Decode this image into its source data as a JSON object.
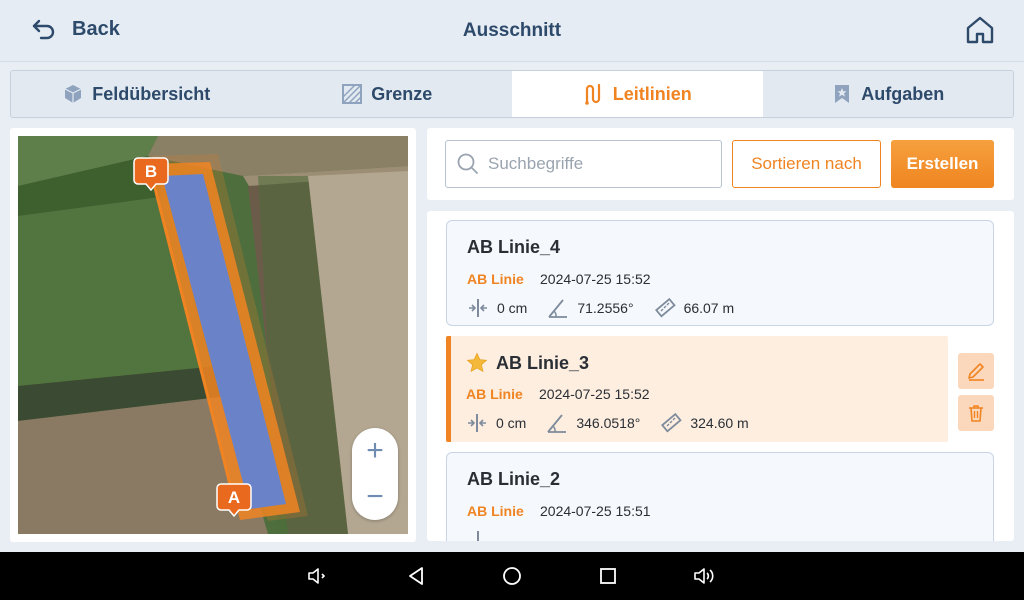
{
  "header": {
    "back_label": "Back",
    "title": "Ausschnitt"
  },
  "tabs": [
    {
      "label": "Feldübersicht",
      "icon": "cube-icon",
      "active": false
    },
    {
      "label": "Grenze",
      "icon": "boundary-icon",
      "active": false
    },
    {
      "label": "Leitlinien",
      "icon": "guidance-lines-icon",
      "active": true
    },
    {
      "label": "Aufgaben",
      "icon": "bookmark-icon",
      "active": false
    }
  ],
  "map": {
    "marker_a": "A",
    "marker_b": "B",
    "zoom_in": "+",
    "zoom_out": "−"
  },
  "toolbar": {
    "search_placeholder": "Suchbegriffe",
    "sort_label": "Sortieren nach",
    "create_label": "Erstellen"
  },
  "lines": [
    {
      "name": "AB Linie_4",
      "type": "AB Linie",
      "date": "2024-07-25 15:52",
      "offset": "0 cm",
      "angle": "71.2556°",
      "length": "66.07 m",
      "selected": false,
      "favorite": false
    },
    {
      "name": "AB Linie_3",
      "type": "AB Linie",
      "date": "2024-07-25 15:52",
      "offset": "0 cm",
      "angle": "346.0518°",
      "length": "324.60 m",
      "selected": true,
      "favorite": true
    },
    {
      "name": "AB Linie_2",
      "type": "AB Linie",
      "date": "2024-07-25 15:51",
      "offset": "",
      "angle": "",
      "length": "",
      "selected": false,
      "favorite": false
    }
  ],
  "colors": {
    "accent": "#f08422",
    "primary_text": "#2e4a6b",
    "route_fill": "#6a82c8"
  }
}
